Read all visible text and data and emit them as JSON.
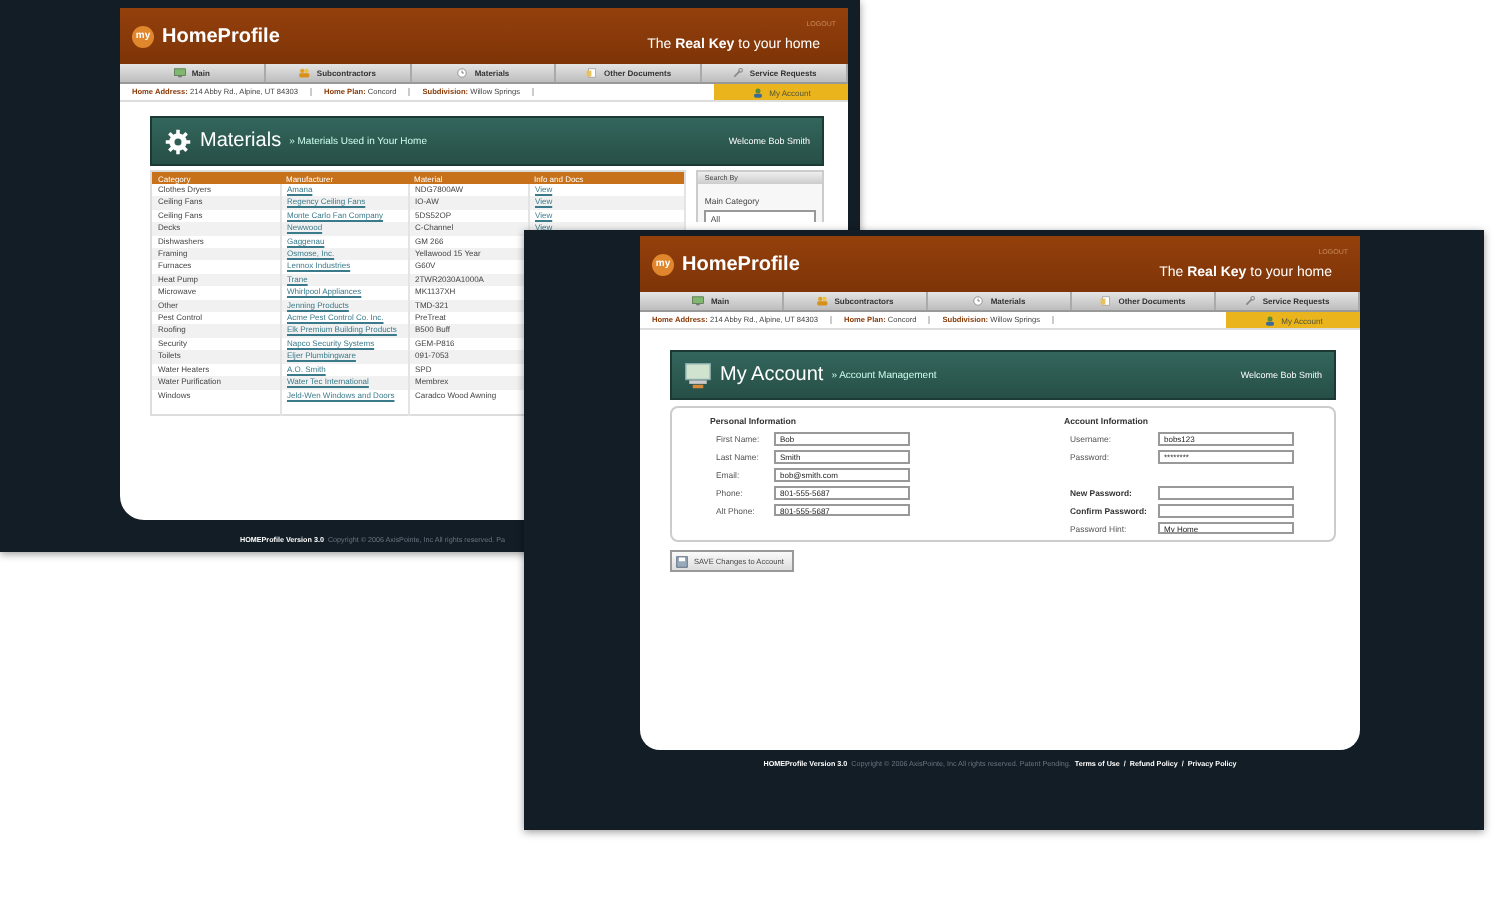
{
  "back_window": {
    "header": {
      "badge": "my",
      "logo": "HomeProfile",
      "tagline": "The **Real Key** to your home",
      "logout": "LOGOUT"
    },
    "nav": [
      {
        "label": "Main"
      },
      {
        "label": "Subcontractors"
      },
      {
        "label": "Materials"
      },
      {
        "label": "Other Documents"
      },
      {
        "label": "Service Requests"
      }
    ],
    "info_bar": [
      {
        "label": "Home Address:",
        "value": "214 Abby Rd., Alpine, UT 84303"
      },
      {
        "label": "Home Plan:",
        "value": "Concord"
      },
      {
        "label": "Subdivision:",
        "value": "Willow Springs"
      }
    ],
    "account_tab": {
      "label": "My Account",
      "selected": true
    },
    "page_header": {
      "title": "Materials",
      "separator": "»",
      "subtitle": "Materials Used in Your Home",
      "welcome": "Welcome Bob Smith"
    },
    "table": {
      "columns": [
        "Category",
        "Manufacturer",
        "Material",
        "Info and Docs"
      ],
      "rows": [
        {
          "category": "Clothes Dryers",
          "manufacturer": "Amana",
          "material": "NDG7800AW",
          "info": "View"
        },
        {
          "category": "Ceiling Fans",
          "manufacturer": "Regency Ceiling Fans",
          "material": "IO-AW",
          "info": "View"
        },
        {
          "category": "Ceiling Fans",
          "manufacturer": "Monte Carlo Fan Company",
          "material": "5DS52OP",
          "info": "View"
        },
        {
          "category": "Decks",
          "manufacturer": "Newwood",
          "material": "C-Channel",
          "info": "View"
        },
        {
          "category": "Dishwashers",
          "manufacturer": "Gaggenau",
          "material": "GM 266"
        },
        {
          "category": "Framing",
          "manufacturer": "Osmose, Inc.",
          "material": "Yellawood 15 Year"
        },
        {
          "category": "Furnaces",
          "manufacturer": "Lennox Industries",
          "material": "G60V"
        },
        {
          "category": "Heat Pump",
          "manufacturer": "Trane",
          "material": "2TWR2030A1000A"
        },
        {
          "category": "Microwave",
          "manufacturer": "Whirlpool Appliances",
          "material": "MK1137XH"
        },
        {
          "category": "Other",
          "manufacturer": "Jenning Products",
          "material": "TMD-321"
        },
        {
          "category": "Pest Control",
          "manufacturer": "Acme Pest Control Co. Inc.",
          "material": "PreTreat"
        },
        {
          "category": "Roofing",
          "manufacturer": "Elk Premium Building Products",
          "material": "B500 Buff"
        },
        {
          "category": "Security",
          "manufacturer": "Napco Security Systems",
          "material": "GEM-P816"
        },
        {
          "category": "Toilets",
          "manufacturer": "Eljer Plumbingware",
          "material": "091-7053"
        },
        {
          "category": "Water Heaters",
          "manufacturer": "A.O. Smith",
          "material": "SPD"
        },
        {
          "category": "Water Purification",
          "manufacturer": "Water Tec International",
          "material": "Membrex"
        },
        {
          "category": "Windows",
          "manufacturer": "Jeld-Wen Windows and Doors",
          "material": "Caradco Wood Awning"
        }
      ]
    },
    "search_panel": {
      "title": "Search By",
      "label": "Main Category",
      "option": "All"
    },
    "footer": {
      "brand": "HOMEProfile Version 3.0",
      "copyright": "Copyright © 2006 AxisPointe, Inc All rights reserved. Pa"
    }
  },
  "front_window": {
    "header": {
      "badge": "my",
      "logo": "HomeProfile",
      "tagline": "The **Real Key** to your home",
      "logout": "LOGOUT"
    },
    "nav": [
      {
        "label": "Main"
      },
      {
        "label": "Subcontractors"
      },
      {
        "label": "Materials"
      },
      {
        "label": "Other Documents"
      },
      {
        "label": "Service Requests"
      }
    ],
    "info_bar": [
      {
        "label": "Home Address:",
        "value": "214 Abby Rd., Alpine, UT 84303"
      },
      {
        "label": "Home Plan:",
        "value": "Concord"
      },
      {
        "label": "Subdivision:",
        "value": "Willow Springs"
      }
    ],
    "account_tab": {
      "label": "My Account",
      "selected": true
    },
    "page_header": {
      "title": "My Account",
      "separator": "»",
      "subtitle": "Account Management",
      "welcome": "Welcome Bob Smith"
    },
    "personal": {
      "title": "Personal Information",
      "fields": [
        {
          "label": "First Name:",
          "value": "Bob",
          "bold": false
        },
        {
          "label": "Last Name:",
          "value": "Smith",
          "bold": false
        },
        {
          "label": "Email:",
          "value": "bob@smith.com",
          "bold": false
        },
        {
          "label": "Phone:",
          "value": "801-555-5687",
          "bold": false
        },
        {
          "label": "Alt Phone:",
          "value": "801-555-5687",
          "bold": false
        }
      ]
    },
    "account": {
      "title": "Account Information",
      "fields": [
        {
          "label": "Username:",
          "value": "bobs123",
          "bold": false
        },
        {
          "label": "Password:",
          "value": "********",
          "bold": false
        }
      ],
      "change_fields": [
        {
          "label": "New Password:",
          "bold": true
        },
        {
          "label": "Confirm Password:",
          "bold": true
        },
        {
          "label": "Password Hint:",
          "value": "My Home",
          "bold": false
        }
      ]
    },
    "save_button": "SAVE Changes to Account",
    "footer": {
      "brand": "HOMEProfile Version 3.0",
      "copyright": "Copyright © 2006 AxisPointe, Inc All rights reserved. Patent Pending.",
      "links": [
        "Terms of Use",
        "Refund Policy",
        "Privacy Policy"
      ],
      "link_separator": "/"
    }
  }
}
